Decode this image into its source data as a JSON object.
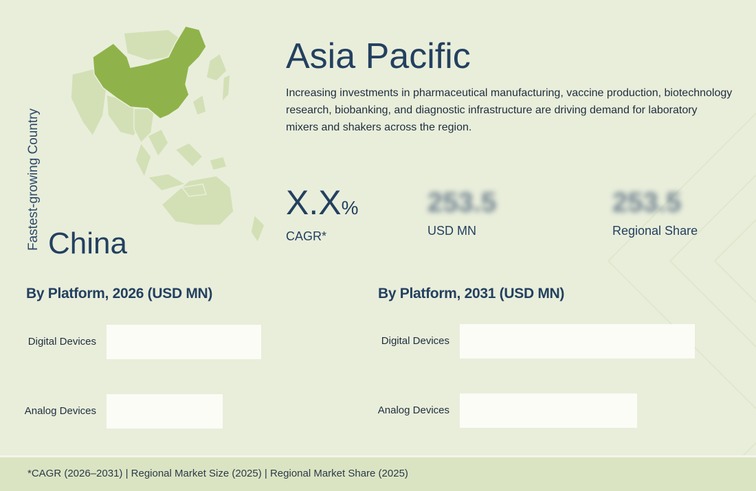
{
  "map": {
    "region": "Asia Pacific",
    "highlighted_country": "China",
    "highlight_color": "#8fb34a",
    "base_color": "#d3e0b6"
  },
  "sidebar": {
    "vertical_label": "Fastest-growing Country",
    "country": "China"
  },
  "region": {
    "title": "Asia Pacific",
    "description": "Increasing investments in pharmaceutical manufacturing, vaccine production, biotechnology research, biobanking, and diagnostic infrastructure are driving demand for laboratory mixers and shakers across the region."
  },
  "stats": {
    "cagr": {
      "value": "X.X",
      "unit": "%",
      "label": "CAGR*"
    },
    "usd": {
      "value": "253.5",
      "label": "USD MN"
    },
    "share": {
      "value": "253.5",
      "label": "Regional Share"
    }
  },
  "chart_data": [
    {
      "type": "bar",
      "title": "By Platform, 2026 (USD MN)",
      "categories": [
        "Digital Devices",
        "Analog Devices"
      ],
      "values": [
        225,
        169
      ],
      "xlim": [
        0,
        400
      ]
    },
    {
      "type": "bar",
      "title": "By Platform, 2031 (USD MN)",
      "categories": [
        "Digital Devices",
        "Analog Devices"
      ],
      "values": [
        342,
        258
      ],
      "xlim": [
        0,
        400
      ]
    }
  ],
  "footer": {
    "note": "*CAGR (2026–2031) | Regional Market Size (2025) | Regional Market Share (2025)"
  },
  "colors": {
    "background": "#e9eedb",
    "text": "#23405f",
    "bar": "#fbfcf6",
    "footer": "#dbe4c2"
  }
}
